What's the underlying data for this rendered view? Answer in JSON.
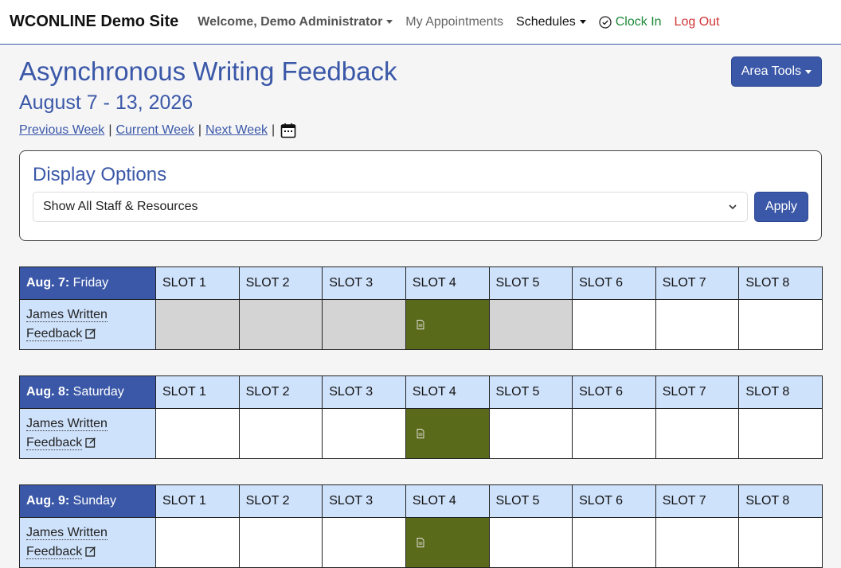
{
  "nav": {
    "brand": "WCONLINE Demo Site",
    "welcome": "Welcome, Demo Administrator",
    "appointments": "My Appointments",
    "schedules": "Schedules",
    "clock_in": "Clock In",
    "log_out": "Log Out"
  },
  "header": {
    "title": "Asynchronous Writing Feedback",
    "dates": "August 7 - 13, 2026",
    "prev_week": "Previous Week",
    "current_week": "Current Week",
    "next_week": "Next Week",
    "separator": "|",
    "area_tools": "Area Tools"
  },
  "display": {
    "title": "Display Options",
    "selected": "Show All Staff & Resources",
    "apply": "Apply"
  },
  "slots": [
    "SLOT 1",
    "SLOT 2",
    "SLOT 3",
    "SLOT 4",
    "SLOT 5",
    "SLOT 6",
    "SLOT 7",
    "SLOT 8"
  ],
  "days": [
    {
      "date": "Aug. 7:",
      "weekday": "Friday",
      "resource_line1": "James Written",
      "resource_line2": "Feedback",
      "slot_states": [
        "closed",
        "closed",
        "closed",
        "booked",
        "closed",
        "open",
        "open",
        "open"
      ]
    },
    {
      "date": "Aug. 8:",
      "weekday": "Saturday",
      "resource_line1": "James Written",
      "resource_line2": "Feedback",
      "slot_states": [
        "open",
        "open",
        "open",
        "booked",
        "open",
        "open",
        "open",
        "open"
      ]
    },
    {
      "date": "Aug. 9:",
      "weekday": "Sunday",
      "resource_line1": "James Written",
      "resource_line2": "Feedback",
      "slot_states": [
        "open",
        "open",
        "open",
        "booked",
        "open",
        "open",
        "open",
        "open"
      ]
    }
  ],
  "colors": {
    "brand_blue": "#3b58a8",
    "slot_header": "#cfe2fb",
    "closed": "#d4d4d4",
    "booked": "#5a6a1b",
    "clock_in": "#1e8a3a",
    "log_out": "#d03434"
  }
}
